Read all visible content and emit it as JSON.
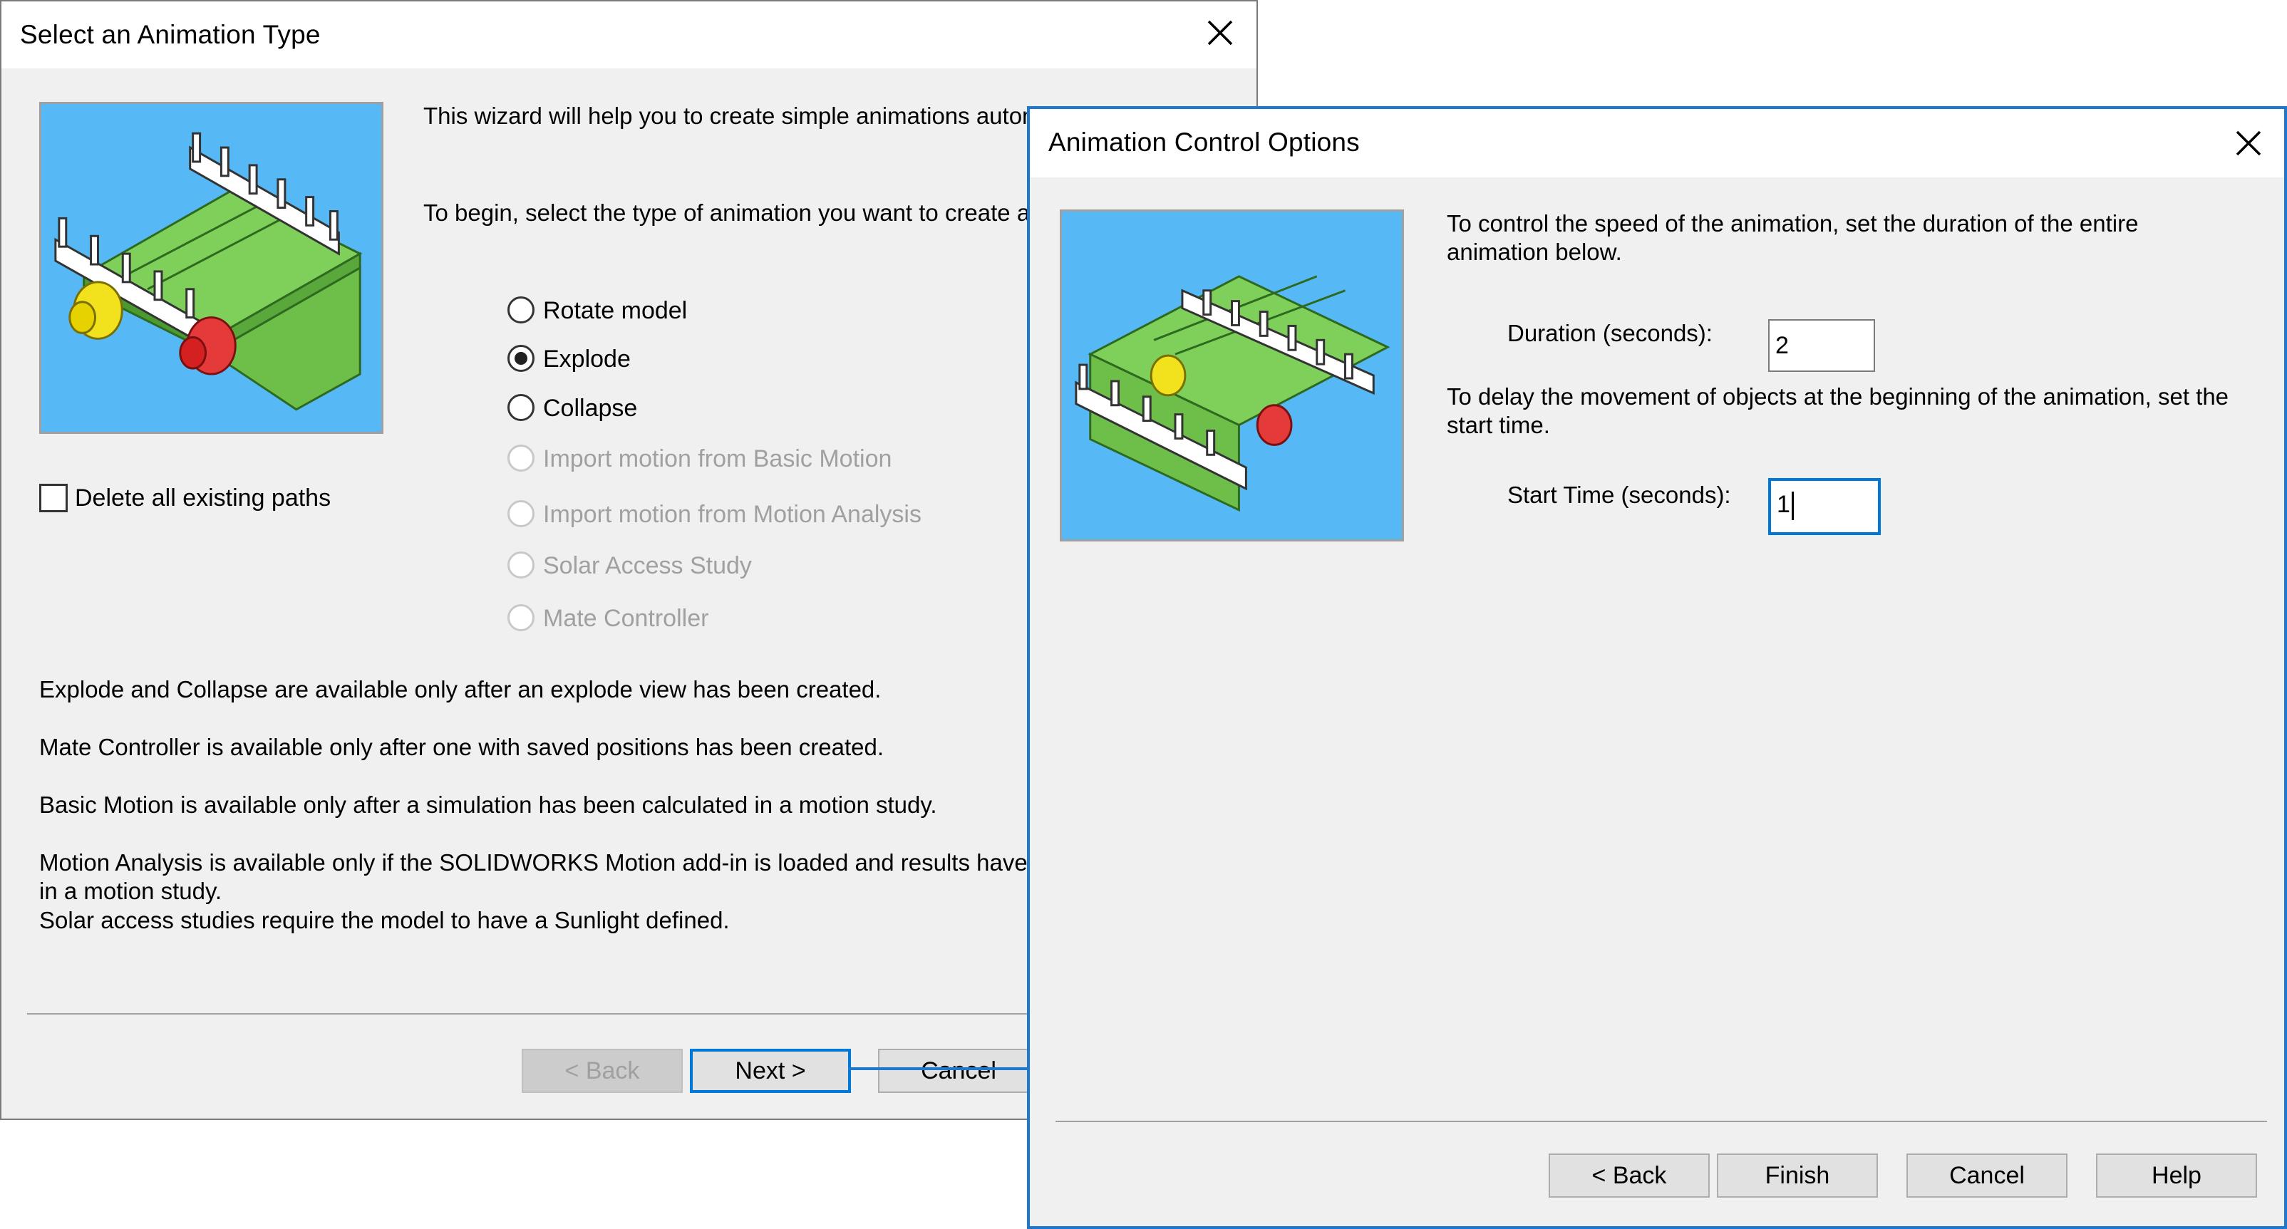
{
  "dialog1": {
    "title": "Select an Animation Type",
    "intro_line1": "This wizard will help you to create simple animations autom",
    "intro_line2": "To begin, select the type of animation you want to create a",
    "options": [
      {
        "label": "Rotate model",
        "checked": false,
        "enabled": true
      },
      {
        "label": "Explode",
        "checked": true,
        "enabled": true
      },
      {
        "label": "Collapse",
        "checked": false,
        "enabled": true
      },
      {
        "label": "Import motion from Basic Motion",
        "checked": false,
        "enabled": false
      },
      {
        "label": "Import motion from Motion Analysis",
        "checked": false,
        "enabled": false
      },
      {
        "label": "Solar Access Study",
        "checked": false,
        "enabled": false
      },
      {
        "label": "Mate Controller",
        "checked": false,
        "enabled": false
      }
    ],
    "delete_paths_label": "Delete all existing paths",
    "notes": [
      "Explode and Collapse are available only after an explode view has been created.",
      "Mate Controller is available only after one with saved positions has been created.",
      "Basic Motion is available only after a simulation has been calculated in a motion study.",
      "Motion Analysis is available only if the SOLIDWORKS Motion add-in is loaded and results have",
      "in a motion study.",
      "Solar access studies require the model to have a Sunlight defined."
    ],
    "buttons": {
      "back": "< Back",
      "next": "Next >",
      "cancel": "Cancel"
    }
  },
  "dialog2": {
    "title": "Animation Control Options",
    "speed_text_line1": "To control the speed of the animation, set the duration of the entire",
    "speed_text_line2": "animation below.",
    "duration_label": "Duration (seconds):",
    "duration_value": "2",
    "delay_text_line1": "To delay the movement of objects at the beginning of the animation, set the",
    "delay_text_line2": "start time.",
    "start_time_label": "Start Time (seconds):",
    "start_time_value": "1",
    "buttons": {
      "back": "< Back",
      "finish": "Finish",
      "cancel": "Cancel",
      "help": "Help"
    }
  },
  "icons": [
    "close-icon",
    "assembly-preview-icon"
  ],
  "colors": {
    "accent": "#0078d7",
    "preview_bg": "#56b8f4",
    "dialog_bg": "#f0f0f0"
  }
}
